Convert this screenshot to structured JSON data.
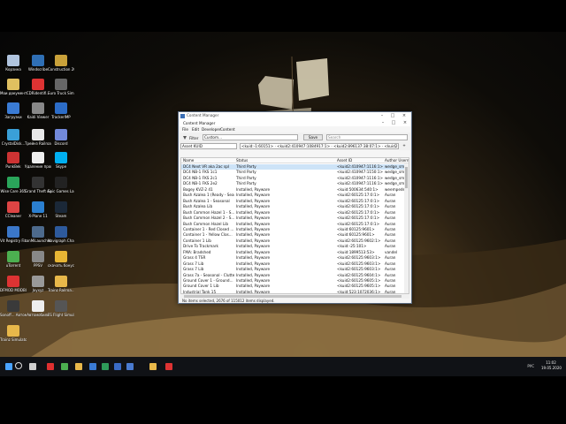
{
  "desktop": {
    "icons": [
      {
        "label": "Корзина",
        "color": "#b0c4de"
      },
      {
        "label": "Windscribe",
        "color": "#2f6fb5"
      },
      {
        "label": "Construction 2015",
        "color": "#c9a13a"
      },
      {
        "label": "Мои документы",
        "color": "#e0c060"
      },
      {
        "label": "CDRidentifi...",
        "color": "#d33"
      },
      {
        "label": "Euro Truck Simulator 2",
        "color": "#666"
      },
      {
        "label": "Загрузки",
        "color": "#3a7bd5"
      },
      {
        "label": "Kaidi Viewer",
        "color": "#888"
      },
      {
        "label": "TrackerIMP",
        "color": "#2c6cc7"
      },
      {
        "label": "CrystalDisk...",
        "color": "#3aa0d8"
      },
      {
        "label": "Трейнз Railroa...",
        "color": "#e8e8e8"
      },
      {
        "label": "Discord",
        "color": "#7289da"
      },
      {
        "label": "PunkBek",
        "color": "#c33"
      },
      {
        "label": "Удаление программ",
        "color": "#eee"
      },
      {
        "label": "Skype",
        "color": "#00aff0"
      },
      {
        "label": "Wise Care 365",
        "color": "#2aa55a"
      },
      {
        "label": "Grand Theft Auto V",
        "color": "#333"
      },
      {
        "label": "Epic Games Launcher",
        "color": "#222"
      },
      {
        "label": "CCleaner",
        "color": "#d44"
      },
      {
        "label": "X-Plane 11",
        "color": "#2b7fd0"
      },
      {
        "label": "Steam",
        "color": "#1b2838"
      },
      {
        "label": "Vit Registry Fix",
        "color": "#3b77c9"
      },
      {
        "label": "tonMiLauncher",
        "color": "#4d6a8c"
      },
      {
        "label": "Navigraph Charts",
        "color": "#2e5a9c"
      },
      {
        "label": "uTorrent",
        "color": "#4caf50"
      },
      {
        "label": "PPSV",
        "color": "#888"
      },
      {
        "label": "скачать бонус",
        "color": "#e7b534"
      },
      {
        "label": "DFMOD MODBUILD",
        "color": "#d33"
      },
      {
        "label": "Joyxyz",
        "color": "#999"
      },
      {
        "label": "Trainz Railroa...",
        "color": "#e8b84a"
      },
      {
        "label": "Sonoff... Автомат...",
        "color": "#3a3a3a"
      },
      {
        "label": "Автомобили",
        "color": "#eee"
      },
      {
        "label": "FS Flight Simulator...",
        "color": "#555"
      },
      {
        "label": "Trainz Simulator 12",
        "color": "#e8b84a"
      }
    ]
  },
  "window": {
    "outer_title": "Content Manager",
    "inner_title": "Content Manager",
    "menu": [
      "File",
      "Edit",
      "Developer",
      "Content"
    ],
    "filter": {
      "label": "Filter",
      "value": "Custom...",
      "save_label": "Save",
      "search_placeholder": "Search"
    },
    "kuid_select": "Asset KUID",
    "kuid_chain": "<kuid:-1:60151> · <kuid2:410947:1084917:1> · <kuid2:896137:38:07:1> · <kuid2:410947:1086:07:1> · <kuid2:410947:1115:1...",
    "columns": [
      "Name",
      "Status",
      "Asset ID",
      "Author Username"
    ],
    "rows": [
      {
        "name": "DC4 Next VR aka 2ac spl",
        "status": "Third Party",
        "asset": "<kuid2:410947:1116:1>",
        "author": "wedge_smiliies",
        "selected": true
      },
      {
        "name": "DC4 NB-1 FKS 1c1",
        "status": "Third Party",
        "asset": "<kuid2:410947:1150:1>",
        "author": "wedge_smiliies",
        "selected": false
      },
      {
        "name": "DC4 NB-1 FKS 2c1",
        "status": "Third Party",
        "asset": "<kuid2:410947:1116:1>",
        "author": "wedge_smiliies",
        "selected": false
      },
      {
        "name": "DC4 NB-1 FKS 2e2",
        "status": "Third Party",
        "asset": "<kuid2:410947:1116:1>",
        "author": "wedge_smiliies",
        "selected": false
      },
      {
        "name": "Bogey KVZ-2 41",
        "status": "Installed, Payware",
        "asset": "<kuid:500634:540:1>",
        "author": "weempede",
        "selected": false
      },
      {
        "name": "Bush Azalea 1 (Ready - Seaso...",
        "status": "Installed, Payware",
        "asset": "<kuid2:60125:17:0:1>",
        "author": "Auran",
        "selected": false
      },
      {
        "name": "Bush Azalea 1 - Seasonal",
        "status": "Installed, Payware",
        "asset": "<kuid2:60125:17:0:1>",
        "author": "Auran",
        "selected": false
      },
      {
        "name": "Bush Azalea Lib",
        "status": "Installed, Payware",
        "asset": "<kuid2:60125:17:0:1>",
        "author": "Auran",
        "selected": false
      },
      {
        "name": "Bush Common Hazel 1 - S...",
        "status": "Installed, Payware",
        "asset": "<kuid2:60125:17:0:1>",
        "author": "Auran",
        "selected": false
      },
      {
        "name": "Bush Common Hazel 2 - S...",
        "status": "Installed, Payware",
        "asset": "<kuid2:60125:17:0:1>",
        "author": "Auran",
        "selected": false
      },
      {
        "name": "Bush Common Hazel Lib",
        "status": "Installed, Payware",
        "asset": "<kuid2:60125:17:0:1>",
        "author": "Auran",
        "selected": false
      },
      {
        "name": "Container 1 - Red Closed ...",
        "status": "Installed, Payware",
        "asset": "<kuid:60125:9601>",
        "author": "Auran",
        "selected": false
      },
      {
        "name": "Container 1 - Yellow Clos...",
        "status": "Installed, Payware",
        "asset": "<kuid:60125:9601>",
        "author": "Auran",
        "selected": false
      },
      {
        "name": "Container 1 Lib",
        "status": "Installed, Payware",
        "asset": "<kuid2:60125:9602:1>",
        "author": "Auran",
        "selected": false
      },
      {
        "name": "Drive To Trackmark",
        "status": "Installed, Payware",
        "asset": "<kuid:-25:101>",
        "author": "Auran",
        "selected": false
      },
      {
        "name": "FMA: Bradshed",
        "status": "Installed, Payware",
        "asset": "<kuid:1899513:53>",
        "author": "vandel",
        "selected": false
      },
      {
        "name": "Grass 4 TSR",
        "status": "Installed, Payware",
        "asset": "<kuid2:60125:9603:1>",
        "author": "Auran",
        "selected": false
      },
      {
        "name": "Grass 7 Lib",
        "status": "Installed, Payware",
        "asset": "<kuid2:60125:9603:1>",
        "author": "Auran",
        "selected": false
      },
      {
        "name": "Grass 7 Lib",
        "status": "Installed, Payware",
        "asset": "<kuid2:60125:9603:1>",
        "author": "Auran",
        "selected": false
      },
      {
        "name": "Grass 7a - Seasonal - Clutter",
        "status": "Installed, Payware",
        "asset": "<kuid2:60125:9604:1>",
        "author": "Auran",
        "selected": false
      },
      {
        "name": "Ground Cover 1 - Ground...",
        "status": "Installed, Payware",
        "asset": "<kuid2:60125:9605:1>",
        "author": "Auran",
        "selected": false
      },
      {
        "name": "Ground Cover 1 Lib",
        "status": "Installed, Payware",
        "asset": "<kuid2:60125:9605:1>",
        "author": "Auran",
        "selected": false
      },
      {
        "name": "Industrial Tank 15",
        "status": "Installed, Payware",
        "asset": "<kuid:523:1072036:1>",
        "author": "Auran",
        "selected": false
      }
    ],
    "status_text": "No items selected, 2676 of 115012 items displayed."
  },
  "taskbar": {
    "items": [
      {
        "name": "start",
        "color": "#4aa3ff"
      },
      {
        "name": "task-view",
        "color": "#cfcfcf"
      },
      {
        "name": "opera",
        "color": "#e03030"
      },
      {
        "name": "chrome",
        "color": "#4caf50"
      },
      {
        "name": "explorer",
        "color": "#e8b84a"
      },
      {
        "name": "store",
        "color": "#3a7bd5"
      },
      {
        "name": "excel",
        "color": "#2e9b5a"
      },
      {
        "name": "word",
        "color": "#3a6bc5"
      },
      {
        "name": "app",
        "color": "#4a7bd0"
      },
      {
        "name": "files",
        "color": "#e8b84a"
      },
      {
        "name": "recorder",
        "color": "#d33"
      }
    ],
    "lang": "РУС",
    "time": "11:02",
    "date": "19.05.2020"
  }
}
